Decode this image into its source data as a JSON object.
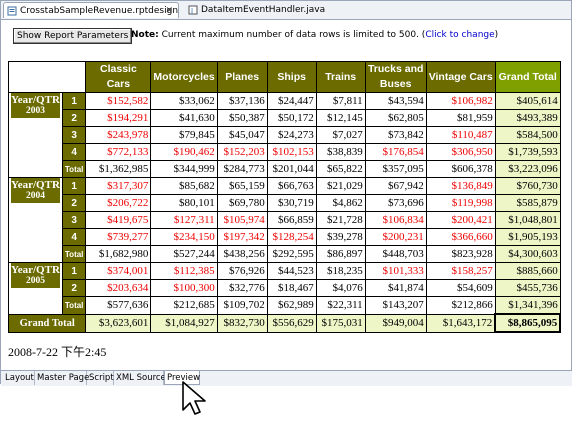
{
  "tabs": [
    {
      "label": "CrosstabSampleRevenue.rptdesign",
      "close": "✕",
      "icon": "report-design-icon"
    },
    {
      "label": "DataItemEventHandler.java",
      "icon": "java-file-icon"
    }
  ],
  "toolbar": {
    "button_label": "Show Report Parameters",
    "note_label": "Note:",
    "note_text": "Current maximum number of data rows is limited to 500. (",
    "note_link": "Click to change",
    "note_end": ")"
  },
  "report": {
    "headers": [
      "Classic Cars",
      "Motorcycles",
      "Planes",
      "Ships",
      "Trains",
      "Trucks and Buses",
      "Vintage Cars",
      "Grand Total"
    ],
    "year_label": "Year/QTR",
    "total_label": "Total",
    "grand_total_label": "Grand Total",
    "years": [
      {
        "year": "2003",
        "rows": [
          {
            "q": "1",
            "values": [
              "$152,582",
              "$33,062",
              "$37,136",
              "$24,447",
              "$7,811",
              "$43,594",
              "$106,982",
              "$405,614"
            ],
            "colors": [
              "r",
              "b",
              "b",
              "b",
              "b",
              "b",
              "r",
              "b"
            ]
          },
          {
            "q": "2",
            "values": [
              "$194,291",
              "$41,630",
              "$50,387",
              "$50,172",
              "$12,145",
              "$62,805",
              "$81,959",
              "$493,389"
            ],
            "colors": [
              "r",
              "b",
              "b",
              "b",
              "b",
              "b",
              "b",
              "b"
            ]
          },
          {
            "q": "3",
            "values": [
              "$243,978",
              "$79,845",
              "$45,047",
              "$24,273",
              "$7,027",
              "$73,842",
              "$110,487",
              "$584,500"
            ],
            "colors": [
              "r",
              "b",
              "b",
              "b",
              "b",
              "b",
              "r",
              "b"
            ]
          },
          {
            "q": "4",
            "values": [
              "$772,133",
              "$190,462",
              "$152,203",
              "$102,153",
              "$38,839",
              "$176,854",
              "$306,950",
              "$1,739,593"
            ],
            "colors": [
              "r",
              "r",
              "r",
              "r",
              "b",
              "r",
              "r",
              "b"
            ]
          },
          {
            "q": "Total",
            "values": [
              "$1,362,985",
              "$344,999",
              "$284,773",
              "$201,044",
              "$65,822",
              "$357,095",
              "$606,378",
              "$3,223,096"
            ],
            "colors": [
              "b",
              "b",
              "b",
              "b",
              "b",
              "b",
              "b",
              "b"
            ]
          }
        ]
      },
      {
        "year": "2004",
        "rows": [
          {
            "q": "1",
            "values": [
              "$317,307",
              "$85,682",
              "$65,159",
              "$66,763",
              "$21,029",
              "$67,942",
              "$136,849",
              "$760,730"
            ],
            "colors": [
              "r",
              "b",
              "b",
              "b",
              "b",
              "b",
              "r",
              "b"
            ]
          },
          {
            "q": "2",
            "values": [
              "$206,722",
              "$80,101",
              "$69,780",
              "$30,719",
              "$4,862",
              "$73,696",
              "$119,998",
              "$585,879"
            ],
            "colors": [
              "r",
              "b",
              "b",
              "b",
              "b",
              "b",
              "r",
              "b"
            ]
          },
          {
            "q": "3",
            "values": [
              "$419,675",
              "$127,311",
              "$105,974",
              "$66,859",
              "$21,728",
              "$106,834",
              "$200,421",
              "$1,048,801"
            ],
            "colors": [
              "r",
              "r",
              "r",
              "b",
              "b",
              "r",
              "r",
              "b"
            ]
          },
          {
            "q": "4",
            "values": [
              "$739,277",
              "$234,150",
              "$197,342",
              "$128,254",
              "$39,278",
              "$200,231",
              "$366,660",
              "$1,905,193"
            ],
            "colors": [
              "r",
              "r",
              "r",
              "r",
              "b",
              "r",
              "r",
              "b"
            ]
          },
          {
            "q": "Total",
            "values": [
              "$1,682,980",
              "$527,244",
              "$438,256",
              "$292,595",
              "$86,897",
              "$448,703",
              "$823,928",
              "$4,300,603"
            ],
            "colors": [
              "b",
              "b",
              "b",
              "b",
              "b",
              "b",
              "b",
              "b"
            ]
          }
        ]
      },
      {
        "year": "2005",
        "rows": [
          {
            "q": "1",
            "values": [
              "$374,001",
              "$112,385",
              "$76,926",
              "$44,523",
              "$18,235",
              "$101,333",
              "$158,257",
              "$885,660"
            ],
            "colors": [
              "r",
              "r",
              "b",
              "b",
              "b",
              "r",
              "r",
              "b"
            ]
          },
          {
            "q": "2",
            "values": [
              "$203,634",
              "$100,300",
              "$32,776",
              "$18,467",
              "$4,076",
              "$41,874",
              "$54,609",
              "$455,736"
            ],
            "colors": [
              "r",
              "r",
              "b",
              "b",
              "b",
              "b",
              "b",
              "b"
            ]
          },
          {
            "q": "Total",
            "values": [
              "$577,636",
              "$212,685",
              "$109,702",
              "$62,989",
              "$22,311",
              "$143,207",
              "$212,866",
              "$1,341,396"
            ],
            "colors": [
              "b",
              "b",
              "b",
              "b",
              "b",
              "b",
              "b",
              "b"
            ]
          }
        ]
      }
    ],
    "grand_total_values": [
      "$3,623,601",
      "$1,084,927",
      "$832,730",
      "$556,629",
      "$175,031",
      "$949,004",
      "$1,643,172",
      "$8,865,095"
    ],
    "colors": {
      "header": "#6b6b00",
      "grand_header": "#80a000",
      "grand_fill": "#eef6c8",
      "highlight": "#ee0000"
    }
  },
  "timestamp": "2008-7-22 下午2:45",
  "bottom_tabs": [
    {
      "label": "Layout"
    },
    {
      "label": "Master Page"
    },
    {
      "label": "Script"
    },
    {
      "label": "XML Source"
    },
    {
      "label": "Preview"
    }
  ]
}
